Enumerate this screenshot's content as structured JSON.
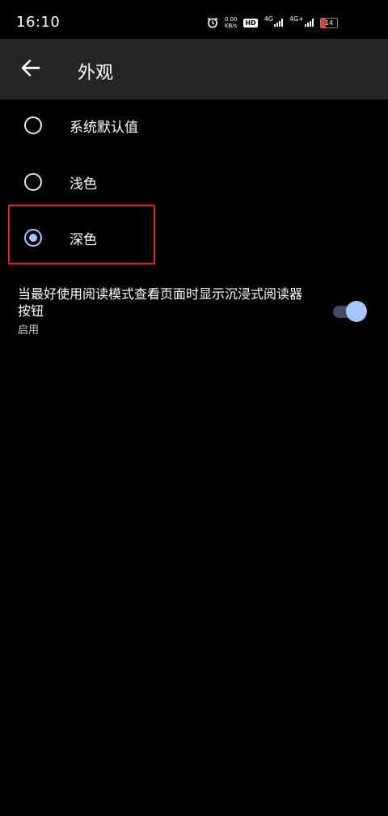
{
  "status_bar": {
    "time": "16:10",
    "net_speed_value": "0.00",
    "net_speed_unit": "KB/s",
    "hd_label": "HD",
    "sim1_type": "4G",
    "sim2_type": "4G+",
    "battery_level": "14",
    "battery_color": "#e23b3b"
  },
  "app_bar": {
    "title": "外观",
    "back_icon": "arrow-left-icon"
  },
  "theme_options": [
    {
      "label": "系统默认值",
      "selected": false
    },
    {
      "label": "浅色",
      "selected": false
    },
    {
      "label": "深色",
      "selected": true
    }
  ],
  "reader_setting": {
    "title": "当最好使用阅读模式查看页面时显示沉浸式阅读器按钮",
    "summary": "启用",
    "enabled": true
  },
  "colors": {
    "accent": "#a7c5ff",
    "app_bar_bg": "#252525",
    "background": "#000000",
    "highlight": "#e0222a"
  }
}
